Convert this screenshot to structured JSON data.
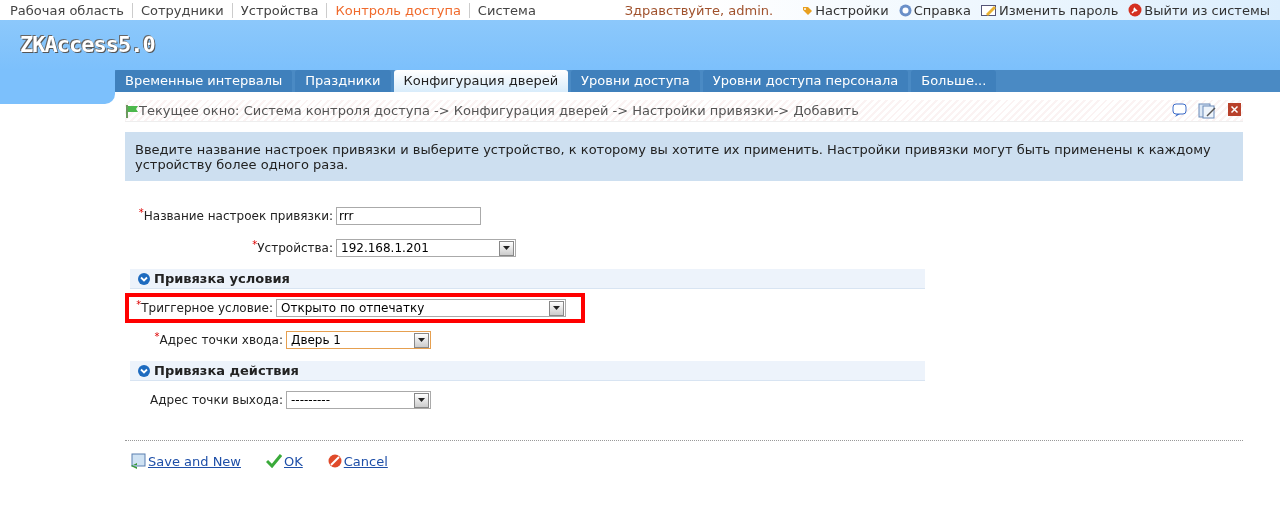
{
  "top_nav": {
    "items": [
      {
        "label": "Рабочая область",
        "selected": false
      },
      {
        "label": "Сотрудники",
        "selected": false
      },
      {
        "label": "Устройства",
        "selected": false
      },
      {
        "label": "Контроль доступа",
        "selected": true
      },
      {
        "label": "Система",
        "selected": false
      }
    ],
    "greeting": "Здравствуйте, admin.",
    "links": [
      {
        "kind": "settings",
        "label": "Настройки"
      },
      {
        "kind": "help",
        "label": "Справка"
      },
      {
        "kind": "password",
        "label": "Изменить пароль"
      },
      {
        "kind": "logout",
        "label": "Выйти из системы"
      }
    ]
  },
  "logo": "ZKAccess5.0",
  "tabs": [
    {
      "label": "Временные интервалы",
      "selected": false
    },
    {
      "label": "Праздники",
      "selected": false
    },
    {
      "label": "Конфигурация дверей",
      "selected": true
    },
    {
      "label": "Уровни доступа",
      "selected": false
    },
    {
      "label": "Уровни доступа персонала",
      "selected": false
    },
    {
      "label": "Больше...",
      "selected": false
    }
  ],
  "breadcrumb": "Текущее окно: Система контроля доступа -> Конфигурация дверей -> Настройки привязки-> Добавить",
  "info": "Введите название настроек привязки и выберите устройство, к которому вы хотите их применить. Настройки привязки могут быть применены к каждому устройству более одного раза.",
  "fields": [
    {
      "kind": "text",
      "label": "Название настроек привязки:",
      "value": "rrr",
      "required_mark": "*"
    },
    {
      "kind": "select",
      "label": "Устройства:",
      "value": "192.168.1.201",
      "required_mark": "*"
    }
  ],
  "sections": [
    {
      "title": "Привязка условия",
      "fields": [
        {
          "kind": "select",
          "label": "Триггерное условие:",
          "value": "Открыто по отпечатку",
          "required_mark": "*",
          "highlighted": true,
          "focused": false
        },
        {
          "kind": "select",
          "label": "Адрес точки хвода:",
          "value": "Дверь 1",
          "required_mark": "*",
          "highlighted": false,
          "focused": true
        }
      ]
    },
    {
      "title": "Привязка действия",
      "fields": [
        {
          "kind": "select",
          "label": "Адрес точки выхода:",
          "value": "---------",
          "highlighted": false,
          "focused": false
        }
      ]
    }
  ],
  "actions": [
    {
      "kind": "save_new",
      "label": "Save and New"
    },
    {
      "kind": "ok",
      "label": "OK"
    },
    {
      "kind": "cancel",
      "label": "Cancel"
    }
  ]
}
